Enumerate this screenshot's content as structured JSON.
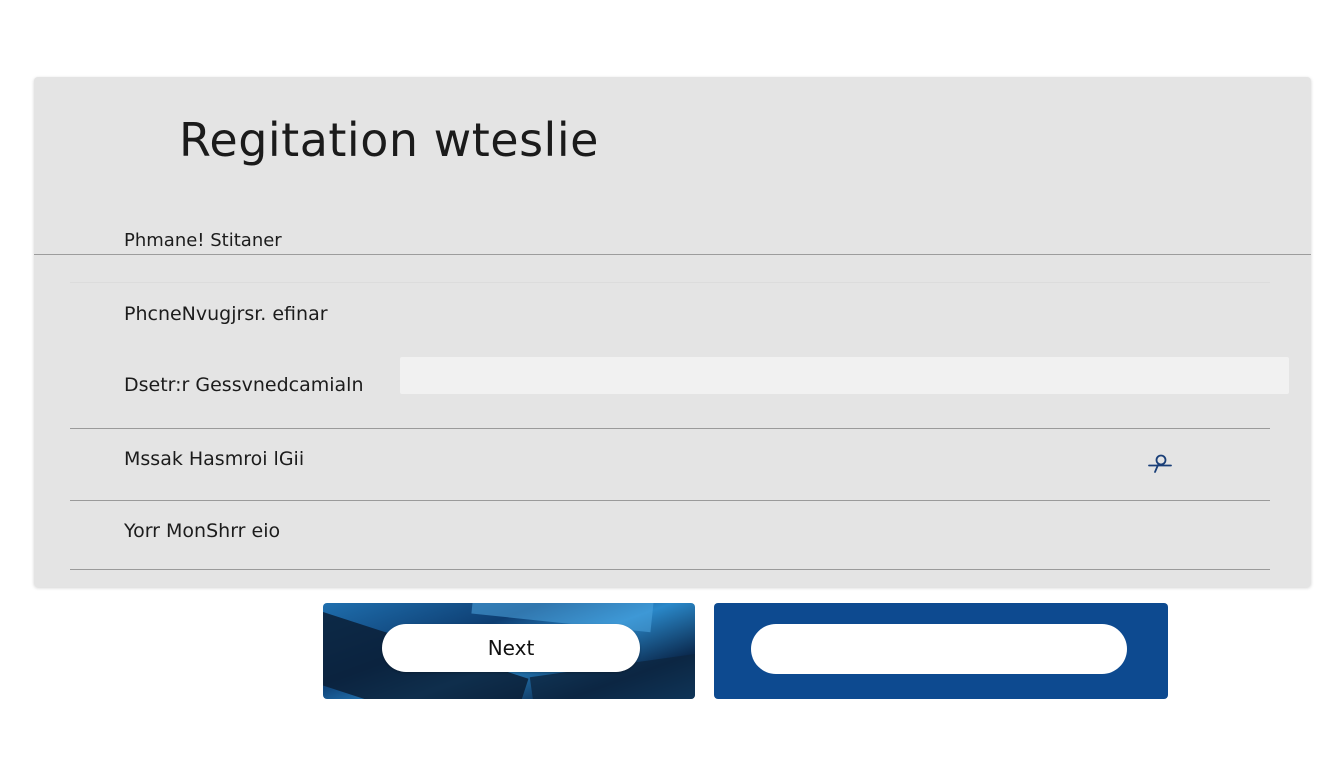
{
  "form": {
    "title": "Regitation wteslie",
    "fields": [
      {
        "label": "Phmane! Stitaner"
      },
      {
        "label": "PhcneNvugjrsr. efinar"
      },
      {
        "label": "Dsetr:r Gessvnedcamialn",
        "input_value": "",
        "placeholder": ""
      },
      {
        "label": "Mssak Hasmroi lGii",
        "icon": "key-icon"
      },
      {
        "label": "Yorr MonShrr eio"
      }
    ]
  },
  "buttons": {
    "next_label": "Next",
    "second_label": ""
  },
  "colors": {
    "card_bg": "#e4e4e4",
    "primary_blue": "#0d4a90",
    "icon_blue": "#1a3f78"
  }
}
